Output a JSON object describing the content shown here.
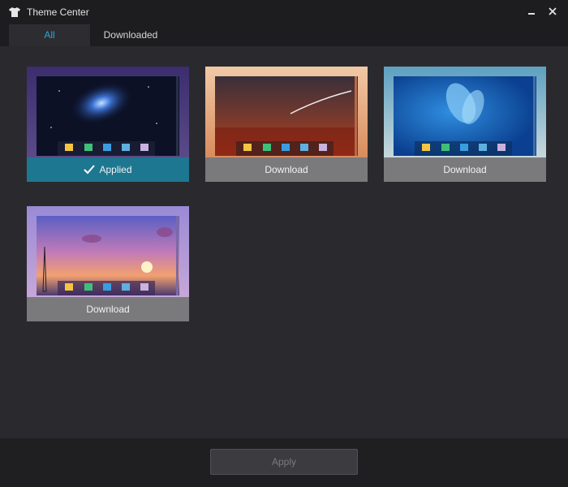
{
  "window": {
    "title": "Theme Center",
    "minimize_icon": "minimize-icon",
    "close_icon": "close-icon",
    "app_icon": "tshirt-icon"
  },
  "tabs": [
    {
      "label": "All",
      "active": true
    },
    {
      "label": "Downloaded",
      "active": false
    }
  ],
  "themes": [
    {
      "name": "galaxy",
      "button_label": "Applied",
      "state": "applied",
      "button_color": "#1e7790"
    },
    {
      "name": "meteor",
      "button_label": "Download",
      "state": "download",
      "button_color": "#7a7a7d"
    },
    {
      "name": "blue-feather",
      "button_label": "Download",
      "state": "download",
      "button_color": "#7a7a7d"
    },
    {
      "name": "sunset",
      "button_label": "Download",
      "state": "download",
      "button_color": "#7a7a7d"
    }
  ],
  "footer": {
    "apply_label": "Apply",
    "apply_enabled": false
  },
  "colors": {
    "accent": "#27a6e0",
    "background": "#2a2a2e",
    "titlebar": "#1d1d20"
  }
}
